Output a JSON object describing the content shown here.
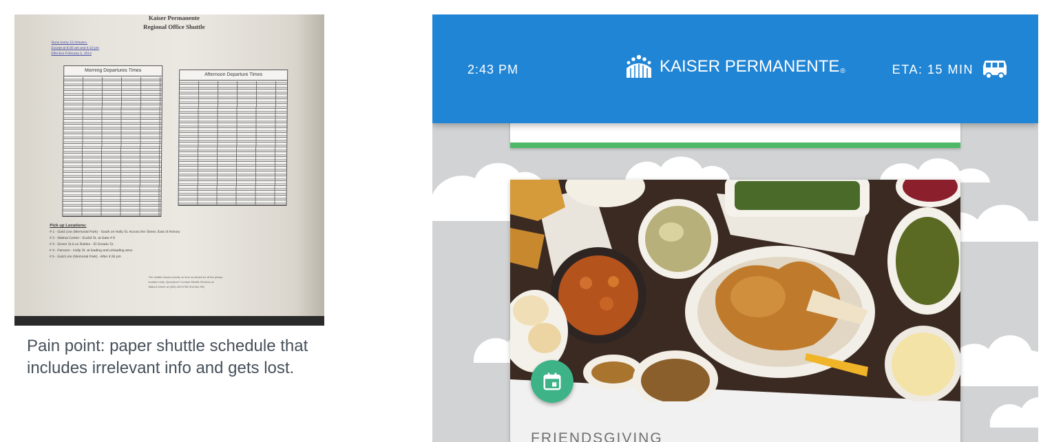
{
  "schedule_photo": {
    "title_line1": "Kaiser Permanente",
    "title_line2": "Regional Office Shuttle",
    "notes": [
      "Runs every 15 minutes.",
      "Except at 9:30 am and 4:10 pm",
      "Effective February 5, 2014"
    ],
    "morning_table_title": "Morning Departures Times",
    "afternoon_table_title": "Afternoon Departure Times",
    "pickup_heading": "Pick up Locations:",
    "pickup_lines": [
      "# 1 - Gold Line (Memorial Park) - South on Holly St. Across the Street, East of Armory",
      "# 2 - Walnut Center - Euclid St. at Gate # 8",
      "# 3 - Green St./Los Robles - El Dorado St.",
      "# 4 - Parsons - Holly St. at loading and unloading area",
      "# 5 - Gold Line (Memorial Park) - After 4:35 pm"
    ],
    "footer_lines": [
      "The shuttle leaves exactly on time so please be at the pickup",
      "location early. Questions? Contact Shuttle Services at",
      "Walnut Center at (626) 405-5782 (Ext line 5H)"
    ]
  },
  "caption": "Pain point: paper shuttle schedule that includes irrelevant info and gets lost.",
  "app": {
    "status_time": "2:43 PM",
    "brand_name": "KAISER PERMANENTE",
    "brand_mark": "®",
    "eta_label": "ETA: 15 MIN",
    "eta_icon": "bus-icon",
    "logo_icon": "kaiser-permanente-logo-icon",
    "card": {
      "fab_icon": "calendar-icon",
      "title": "FRIENDSGIVING"
    },
    "colors": {
      "header_blue": "#2185d5",
      "accent_green": "#4db866",
      "fab_green": "#3eb387",
      "background_gray": "#d2d3d4"
    }
  }
}
